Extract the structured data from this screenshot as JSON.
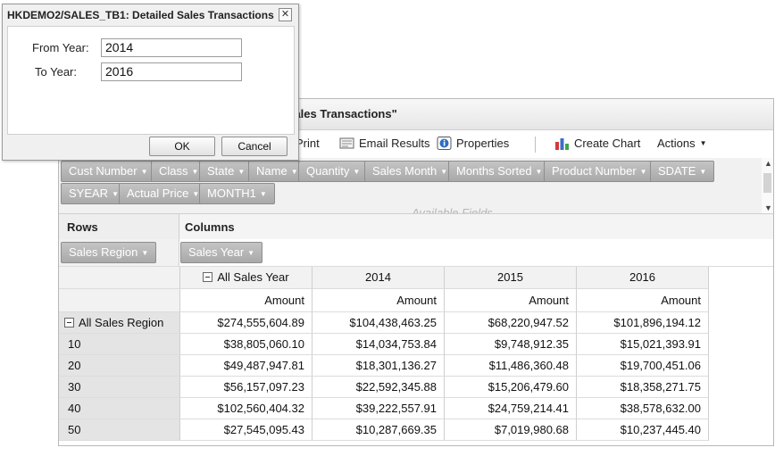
{
  "dialog": {
    "title": "HKDEMO2/SALES_TB1: Detailed Sales Transactions",
    "close_glyph": "✕",
    "from_year_label": "From Year:",
    "from_year_value": "2014",
    "to_year_label": "To Year:",
    "to_year_value": "2016",
    "ok_label": "OK",
    "cancel_label": "Cancel"
  },
  "main": {
    "title": "ed Sales Transactions\"",
    "toolbar": {
      "print": "Print",
      "email_results": "Email Results",
      "properties": "Properties",
      "create_chart": "Create Chart",
      "actions": "Actions"
    },
    "fields": [
      "Cust Number",
      "Class",
      "State",
      "Name",
      "Quantity",
      "Sales Month",
      "Months Sorted",
      "Product Number",
      "SDATE",
      "SYEAR",
      "Actual Price",
      "MONTH1"
    ],
    "available_fields_text": "Available Fields",
    "rows_label": "Rows",
    "columns_label": "Columns",
    "row_field": "Sales Region",
    "column_field": "Sales Year"
  },
  "table": {
    "col_headers": [
      "All Sales Year",
      "2014",
      "2015",
      "2016"
    ],
    "measure": "Amount",
    "rows": [
      {
        "label": "All Sales Region",
        "values": [
          "$274,555,604.89",
          "$104,438,463.25",
          "$68,220,947.52",
          "$101,896,194.12"
        ]
      },
      {
        "label": "10",
        "values": [
          "$38,805,060.10",
          "$14,034,753.84",
          "$9,748,912.35",
          "$15,021,393.91"
        ]
      },
      {
        "label": "20",
        "values": [
          "$49,487,947.81",
          "$18,301,136.27",
          "$11,486,360.48",
          "$19,700,451.06"
        ]
      },
      {
        "label": "30",
        "values": [
          "$56,157,097.23",
          "$22,592,345.88",
          "$15,206,479.60",
          "$18,358,271.75"
        ]
      },
      {
        "label": "40",
        "values": [
          "$102,560,404.32",
          "$39,222,557.91",
          "$24,759,214.41",
          "$38,578,632.00"
        ]
      },
      {
        "label": "50",
        "values": [
          "$27,545,095.43",
          "$10,287,669.35",
          "$7,019,980.68",
          "$10,237,445.40"
        ]
      }
    ]
  }
}
